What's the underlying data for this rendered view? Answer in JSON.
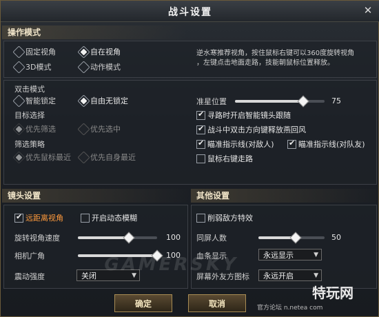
{
  "window": {
    "title": "战斗设置",
    "close_icon": "close-icon"
  },
  "operation": {
    "header": "操作模式",
    "options": [
      {
        "label": "固定视角",
        "selected": false
      },
      {
        "label": "自在视角",
        "selected": true
      },
      {
        "label": "3D模式",
        "selected": false
      },
      {
        "label": "动作模式",
        "selected": false
      }
    ],
    "hint_line1": "逆水寒推荐视角，按住鼠标右键可以360度旋转视角",
    "hint_line2": "，左键点击地面走路，技能朝鼠标位置释放。"
  },
  "combat": {
    "double_click_title": "双击模式",
    "double_click_options": [
      {
        "label": "智能锁定",
        "selected": false
      },
      {
        "label": "自由无锁定",
        "selected": true
      }
    ],
    "target_title": "目标选择",
    "target_options": [
      {
        "label": "优先筛选",
        "selected": true,
        "disabled": true
      },
      {
        "label": "优先选中",
        "selected": false,
        "disabled": true
      }
    ],
    "filter_title": "筛选策略",
    "filter_options": [
      {
        "label": "优先鼠标最近",
        "selected": true,
        "disabled": true
      },
      {
        "label": "优先自身最近",
        "selected": false,
        "disabled": true
      }
    ],
    "crosshair_label": "准星位置",
    "crosshair_value": "75",
    "crosshair_level": 0.75,
    "checks": [
      {
        "label": "寻路时开启智能镜头跟随",
        "checked": true
      },
      {
        "label": "战斗中双击方向键释放燕回风",
        "checked": true
      },
      {
        "label": "瞄准指示线(对敌人)",
        "checked": true
      },
      {
        "label": "瞄准指示线(对队友)",
        "checked": true
      },
      {
        "label": "鼠标右键走路",
        "checked": false
      }
    ]
  },
  "camera": {
    "header": "镜头设置",
    "far_view": {
      "label": "远距离视角",
      "checked": true
    },
    "dynamic_blur": {
      "label": "开启动态模糊",
      "checked": false
    },
    "rotate_speed": {
      "label": "旋转视角速度",
      "value": "100",
      "level": 0.7
    },
    "fov": {
      "label": "相机广角",
      "value": "100",
      "level": 1.0
    },
    "shake": {
      "label": "震动强度",
      "selected": "关闭"
    }
  },
  "other": {
    "header": "其他设置",
    "weaken_effects": {
      "label": "削弱敌方特效",
      "checked": false
    },
    "same_screen": {
      "label": "同屏人数",
      "value": "50",
      "level": 0.55
    },
    "hp_bar": {
      "label": "血条显示",
      "selected": "永远显示"
    },
    "offscreen_icon": {
      "label": "屏幕外友方图标",
      "selected": "永远开启"
    }
  },
  "footer": {
    "confirm": "确定",
    "cancel": "取消"
  },
  "watermarks": {
    "gamersky": "GAMERSKY",
    "site": "官方论坛 n.netea",
    "site_suffix": "com",
    "brand": "特玩网"
  }
}
